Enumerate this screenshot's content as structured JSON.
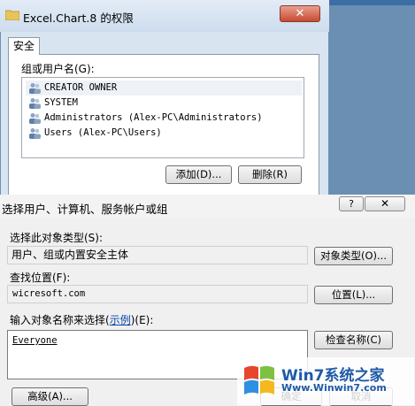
{
  "background": {
    "color": "#6a8fb3"
  },
  "permissions_window": {
    "title": "Excel.Chart.8 的权限",
    "close_label": "✕",
    "tab_label": "安全",
    "group_label": "组或用户名(G):",
    "users": [
      {
        "name": "CREATOR OWNER",
        "icon": "user-group-icon"
      },
      {
        "name": "SYSTEM",
        "icon": "user-group-icon"
      },
      {
        "name": "Administrators (Alex-PC\\Administrators)",
        "icon": "user-group-icon"
      },
      {
        "name": "Users (Alex-PC\\Users)",
        "icon": "user-group-icon"
      }
    ],
    "add_label": "添加(D)...",
    "remove_label": "删除(R)"
  },
  "select_dialog": {
    "title": "选择用户、计算机、服务帐户或组",
    "help_label": "?",
    "close_label": "✕",
    "object_type_label": "选择此对象类型(S):",
    "object_type_value": "用户、组或内置安全主体",
    "object_type_button": "对象类型(O)...",
    "location_label": "查找位置(F):",
    "location_value": "wicresoft.com",
    "location_button": "位置(L)...",
    "enter_label_prefix": "输入对象名称来选择(",
    "enter_label_link": "示例",
    "enter_label_suffix": ")(E):",
    "name_value": "Everyone",
    "check_button": "检查名称(C)",
    "advanced_button": "高级(A)...",
    "ok_button": "确定",
    "cancel_button": "取消"
  },
  "watermark": {
    "text": "Win7系统之家",
    "url": "Www.Winwin7.com"
  }
}
